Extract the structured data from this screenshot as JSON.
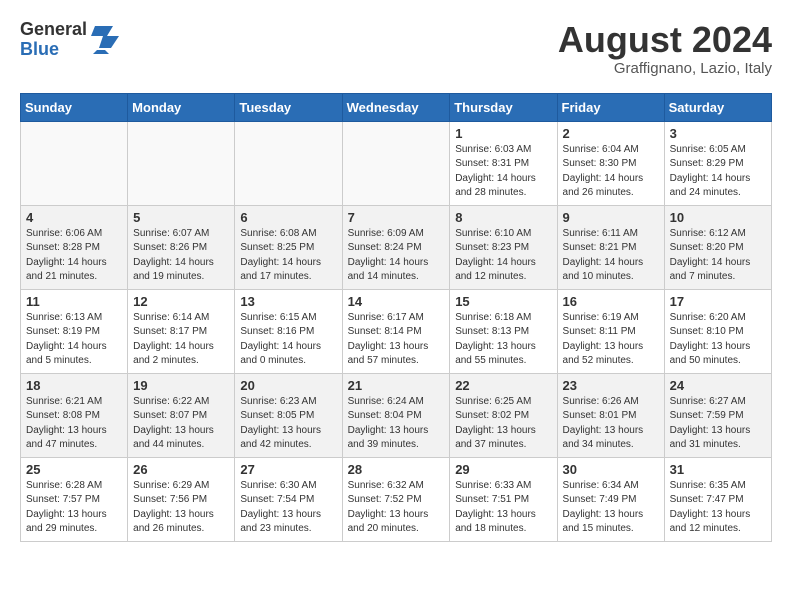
{
  "header": {
    "logo_general": "General",
    "logo_blue": "Blue",
    "month_title": "August 2024",
    "subtitle": "Graffignano, Lazio, Italy"
  },
  "weekdays": [
    "Sunday",
    "Monday",
    "Tuesday",
    "Wednesday",
    "Thursday",
    "Friday",
    "Saturday"
  ],
  "weeks": [
    [
      {
        "day": "",
        "info": ""
      },
      {
        "day": "",
        "info": ""
      },
      {
        "day": "",
        "info": ""
      },
      {
        "day": "",
        "info": ""
      },
      {
        "day": "1",
        "info": "Sunrise: 6:03 AM\nSunset: 8:31 PM\nDaylight: 14 hours\nand 28 minutes."
      },
      {
        "day": "2",
        "info": "Sunrise: 6:04 AM\nSunset: 8:30 PM\nDaylight: 14 hours\nand 26 minutes."
      },
      {
        "day": "3",
        "info": "Sunrise: 6:05 AM\nSunset: 8:29 PM\nDaylight: 14 hours\nand 24 minutes."
      }
    ],
    [
      {
        "day": "4",
        "info": "Sunrise: 6:06 AM\nSunset: 8:28 PM\nDaylight: 14 hours\nand 21 minutes."
      },
      {
        "day": "5",
        "info": "Sunrise: 6:07 AM\nSunset: 8:26 PM\nDaylight: 14 hours\nand 19 minutes."
      },
      {
        "day": "6",
        "info": "Sunrise: 6:08 AM\nSunset: 8:25 PM\nDaylight: 14 hours\nand 17 minutes."
      },
      {
        "day": "7",
        "info": "Sunrise: 6:09 AM\nSunset: 8:24 PM\nDaylight: 14 hours\nand 14 minutes."
      },
      {
        "day": "8",
        "info": "Sunrise: 6:10 AM\nSunset: 8:23 PM\nDaylight: 14 hours\nand 12 minutes."
      },
      {
        "day": "9",
        "info": "Sunrise: 6:11 AM\nSunset: 8:21 PM\nDaylight: 14 hours\nand 10 minutes."
      },
      {
        "day": "10",
        "info": "Sunrise: 6:12 AM\nSunset: 8:20 PM\nDaylight: 14 hours\nand 7 minutes."
      }
    ],
    [
      {
        "day": "11",
        "info": "Sunrise: 6:13 AM\nSunset: 8:19 PM\nDaylight: 14 hours\nand 5 minutes."
      },
      {
        "day": "12",
        "info": "Sunrise: 6:14 AM\nSunset: 8:17 PM\nDaylight: 14 hours\nand 2 minutes."
      },
      {
        "day": "13",
        "info": "Sunrise: 6:15 AM\nSunset: 8:16 PM\nDaylight: 14 hours\nand 0 minutes."
      },
      {
        "day": "14",
        "info": "Sunrise: 6:17 AM\nSunset: 8:14 PM\nDaylight: 13 hours\nand 57 minutes."
      },
      {
        "day": "15",
        "info": "Sunrise: 6:18 AM\nSunset: 8:13 PM\nDaylight: 13 hours\nand 55 minutes."
      },
      {
        "day": "16",
        "info": "Sunrise: 6:19 AM\nSunset: 8:11 PM\nDaylight: 13 hours\nand 52 minutes."
      },
      {
        "day": "17",
        "info": "Sunrise: 6:20 AM\nSunset: 8:10 PM\nDaylight: 13 hours\nand 50 minutes."
      }
    ],
    [
      {
        "day": "18",
        "info": "Sunrise: 6:21 AM\nSunset: 8:08 PM\nDaylight: 13 hours\nand 47 minutes."
      },
      {
        "day": "19",
        "info": "Sunrise: 6:22 AM\nSunset: 8:07 PM\nDaylight: 13 hours\nand 44 minutes."
      },
      {
        "day": "20",
        "info": "Sunrise: 6:23 AM\nSunset: 8:05 PM\nDaylight: 13 hours\nand 42 minutes."
      },
      {
        "day": "21",
        "info": "Sunrise: 6:24 AM\nSunset: 8:04 PM\nDaylight: 13 hours\nand 39 minutes."
      },
      {
        "day": "22",
        "info": "Sunrise: 6:25 AM\nSunset: 8:02 PM\nDaylight: 13 hours\nand 37 minutes."
      },
      {
        "day": "23",
        "info": "Sunrise: 6:26 AM\nSunset: 8:01 PM\nDaylight: 13 hours\nand 34 minutes."
      },
      {
        "day": "24",
        "info": "Sunrise: 6:27 AM\nSunset: 7:59 PM\nDaylight: 13 hours\nand 31 minutes."
      }
    ],
    [
      {
        "day": "25",
        "info": "Sunrise: 6:28 AM\nSunset: 7:57 PM\nDaylight: 13 hours\nand 29 minutes."
      },
      {
        "day": "26",
        "info": "Sunrise: 6:29 AM\nSunset: 7:56 PM\nDaylight: 13 hours\nand 26 minutes."
      },
      {
        "day": "27",
        "info": "Sunrise: 6:30 AM\nSunset: 7:54 PM\nDaylight: 13 hours\nand 23 minutes."
      },
      {
        "day": "28",
        "info": "Sunrise: 6:32 AM\nSunset: 7:52 PM\nDaylight: 13 hours\nand 20 minutes."
      },
      {
        "day": "29",
        "info": "Sunrise: 6:33 AM\nSunset: 7:51 PM\nDaylight: 13 hours\nand 18 minutes."
      },
      {
        "day": "30",
        "info": "Sunrise: 6:34 AM\nSunset: 7:49 PM\nDaylight: 13 hours\nand 15 minutes."
      },
      {
        "day": "31",
        "info": "Sunrise: 6:35 AM\nSunset: 7:47 PM\nDaylight: 13 hours\nand 12 minutes."
      }
    ]
  ]
}
